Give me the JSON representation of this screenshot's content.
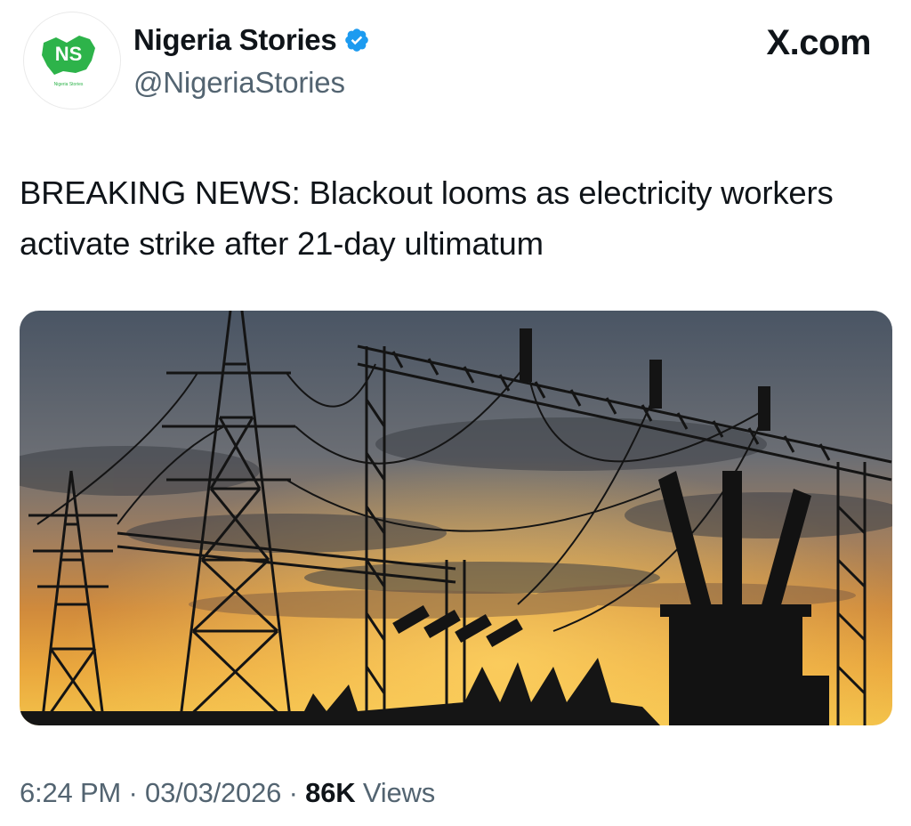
{
  "author": {
    "name": "Nigeria Stories",
    "handle": "@NigeriaStories",
    "verified": true,
    "avatar_text": "NS",
    "avatar_subtext": "Nigeria Stories"
  },
  "source_label": "X.com",
  "tweet": {
    "text": "BREAKING NEWS: Blackout looms as electricity workers activate strike after 21-day ultimatum"
  },
  "meta": {
    "time": "6:24 PM",
    "separator": "·",
    "date": "03/03/2026",
    "views_count": "86K",
    "views_label": "Views"
  },
  "colors": {
    "verified_badge": "#1d9bf0",
    "logo_green": "#2db34a",
    "secondary_text": "#536471"
  }
}
